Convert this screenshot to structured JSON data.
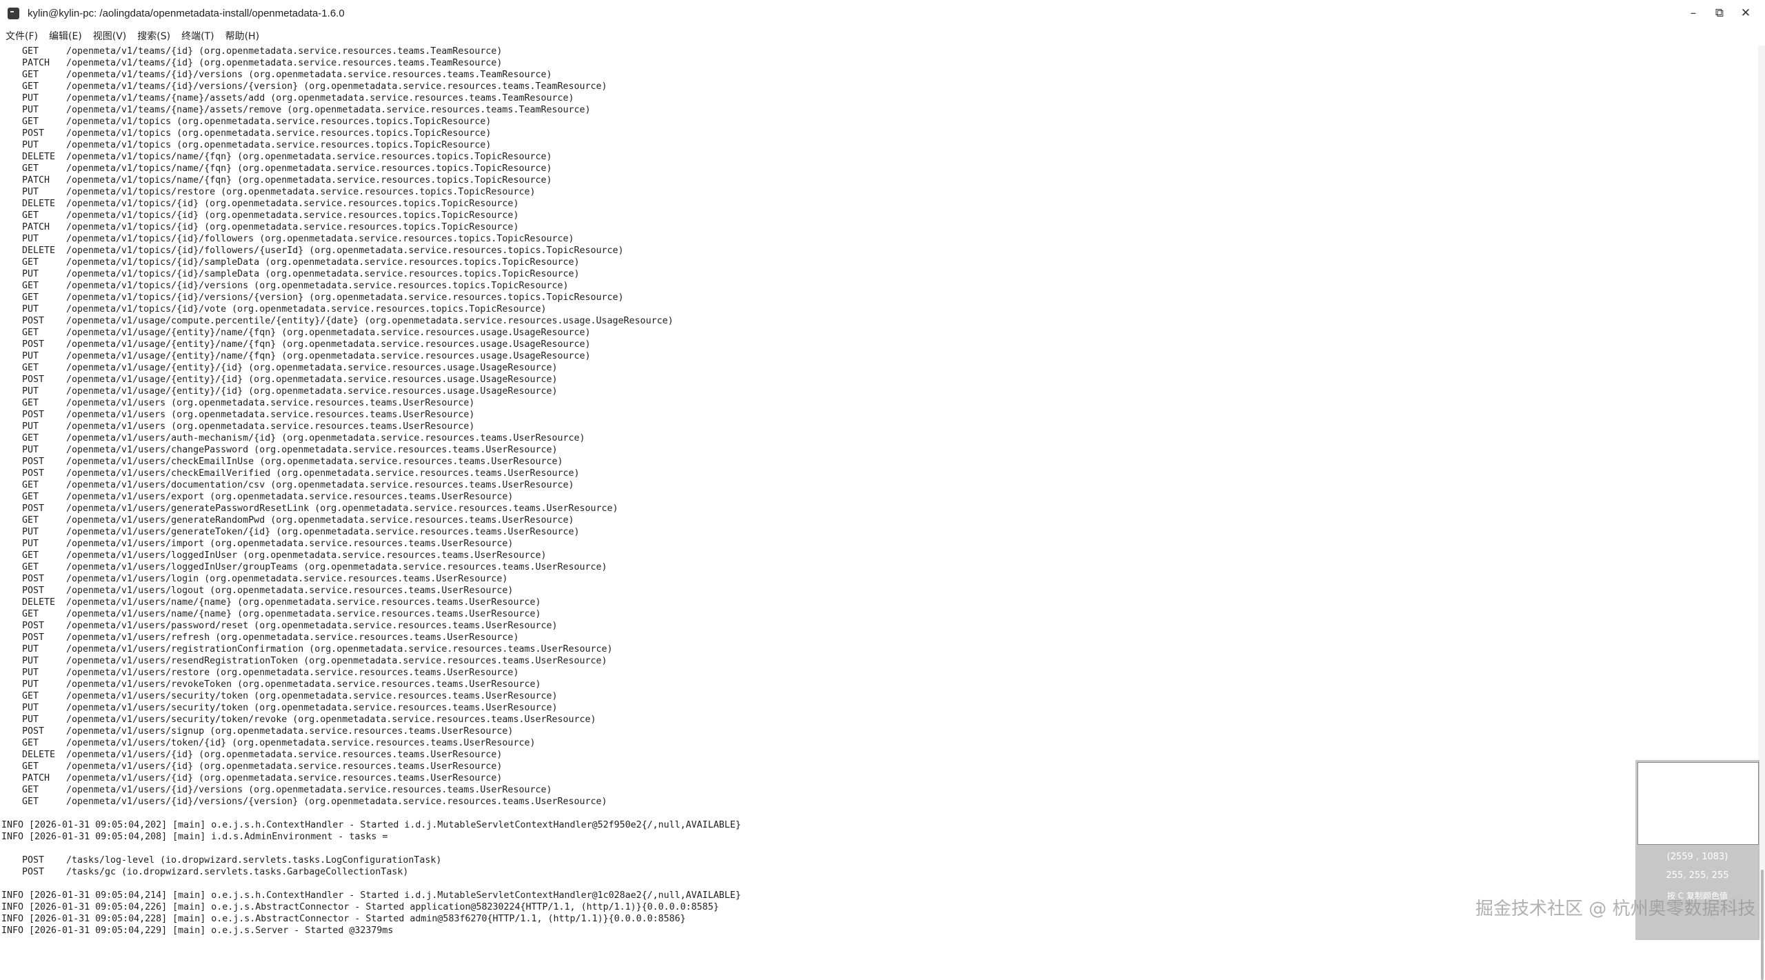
{
  "window": {
    "title": "kylin@kylin-pc: /aolingdata/openmetadata-install/openmetadata-1.6.0",
    "minimize_glyph": "–",
    "maximize_glyph": "⧉",
    "close_glyph": "✕"
  },
  "menu": [
    "文件(F)",
    "编辑(E)",
    "视图(V)",
    "搜索(S)",
    "终端(T)",
    "帮助(H)"
  ],
  "routes": [
    {
      "method": "GET",
      "path": "/openmeta/v1/teams/{id} (org.openmetadata.service.resources.teams.TeamResource)"
    },
    {
      "method": "PATCH",
      "path": "/openmeta/v1/teams/{id} (org.openmetadata.service.resources.teams.TeamResource)"
    },
    {
      "method": "GET",
      "path": "/openmeta/v1/teams/{id}/versions (org.openmetadata.service.resources.teams.TeamResource)"
    },
    {
      "method": "GET",
      "path": "/openmeta/v1/teams/{id}/versions/{version} (org.openmetadata.service.resources.teams.TeamResource)"
    },
    {
      "method": "PUT",
      "path": "/openmeta/v1/teams/{name}/assets/add (org.openmetadata.service.resources.teams.TeamResource)"
    },
    {
      "method": "PUT",
      "path": "/openmeta/v1/teams/{name}/assets/remove (org.openmetadata.service.resources.teams.TeamResource)"
    },
    {
      "method": "GET",
      "path": "/openmeta/v1/topics (org.openmetadata.service.resources.topics.TopicResource)"
    },
    {
      "method": "POST",
      "path": "/openmeta/v1/topics (org.openmetadata.service.resources.topics.TopicResource)"
    },
    {
      "method": "PUT",
      "path": "/openmeta/v1/topics (org.openmetadata.service.resources.topics.TopicResource)"
    },
    {
      "method": "DELETE",
      "path": "/openmeta/v1/topics/name/{fqn} (org.openmetadata.service.resources.topics.TopicResource)"
    },
    {
      "method": "GET",
      "path": "/openmeta/v1/topics/name/{fqn} (org.openmetadata.service.resources.topics.TopicResource)"
    },
    {
      "method": "PATCH",
      "path": "/openmeta/v1/topics/name/{fqn} (org.openmetadata.service.resources.topics.TopicResource)"
    },
    {
      "method": "PUT",
      "path": "/openmeta/v1/topics/restore (org.openmetadata.service.resources.topics.TopicResource)"
    },
    {
      "method": "DELETE",
      "path": "/openmeta/v1/topics/{id} (org.openmetadata.service.resources.topics.TopicResource)"
    },
    {
      "method": "GET",
      "path": "/openmeta/v1/topics/{id} (org.openmetadata.service.resources.topics.TopicResource)"
    },
    {
      "method": "PATCH",
      "path": "/openmeta/v1/topics/{id} (org.openmetadata.service.resources.topics.TopicResource)"
    },
    {
      "method": "PUT",
      "path": "/openmeta/v1/topics/{id}/followers (org.openmetadata.service.resources.topics.TopicResource)"
    },
    {
      "method": "DELETE",
      "path": "/openmeta/v1/topics/{id}/followers/{userId} (org.openmetadata.service.resources.topics.TopicResource)"
    },
    {
      "method": "GET",
      "path": "/openmeta/v1/topics/{id}/sampleData (org.openmetadata.service.resources.topics.TopicResource)"
    },
    {
      "method": "PUT",
      "path": "/openmeta/v1/topics/{id}/sampleData (org.openmetadata.service.resources.topics.TopicResource)"
    },
    {
      "method": "GET",
      "path": "/openmeta/v1/topics/{id}/versions (org.openmetadata.service.resources.topics.TopicResource)"
    },
    {
      "method": "GET",
      "path": "/openmeta/v1/topics/{id}/versions/{version} (org.openmetadata.service.resources.topics.TopicResource)"
    },
    {
      "method": "PUT",
      "path": "/openmeta/v1/topics/{id}/vote (org.openmetadata.service.resources.topics.TopicResource)"
    },
    {
      "method": "POST",
      "path": "/openmeta/v1/usage/compute.percentile/{entity}/{date} (org.openmetadata.service.resources.usage.UsageResource)"
    },
    {
      "method": "GET",
      "path": "/openmeta/v1/usage/{entity}/name/{fqn} (org.openmetadata.service.resources.usage.UsageResource)"
    },
    {
      "method": "POST",
      "path": "/openmeta/v1/usage/{entity}/name/{fqn} (org.openmetadata.service.resources.usage.UsageResource)"
    },
    {
      "method": "PUT",
      "path": "/openmeta/v1/usage/{entity}/name/{fqn} (org.openmetadata.service.resources.usage.UsageResource)"
    },
    {
      "method": "GET",
      "path": "/openmeta/v1/usage/{entity}/{id} (org.openmetadata.service.resources.usage.UsageResource)"
    },
    {
      "method": "POST",
      "path": "/openmeta/v1/usage/{entity}/{id} (org.openmetadata.service.resources.usage.UsageResource)"
    },
    {
      "method": "PUT",
      "path": "/openmeta/v1/usage/{entity}/{id} (org.openmetadata.service.resources.usage.UsageResource)"
    },
    {
      "method": "GET",
      "path": "/openmeta/v1/users (org.openmetadata.service.resources.teams.UserResource)"
    },
    {
      "method": "POST",
      "path": "/openmeta/v1/users (org.openmetadata.service.resources.teams.UserResource)"
    },
    {
      "method": "PUT",
      "path": "/openmeta/v1/users (org.openmetadata.service.resources.teams.UserResource)"
    },
    {
      "method": "GET",
      "path": "/openmeta/v1/users/auth-mechanism/{id} (org.openmetadata.service.resources.teams.UserResource)"
    },
    {
      "method": "PUT",
      "path": "/openmeta/v1/users/changePassword (org.openmetadata.service.resources.teams.UserResource)"
    },
    {
      "method": "POST",
      "path": "/openmeta/v1/users/checkEmailInUse (org.openmetadata.service.resources.teams.UserResource)"
    },
    {
      "method": "POST",
      "path": "/openmeta/v1/users/checkEmailVerified (org.openmetadata.service.resources.teams.UserResource)"
    },
    {
      "method": "GET",
      "path": "/openmeta/v1/users/documentation/csv (org.openmetadata.service.resources.teams.UserResource)"
    },
    {
      "method": "GET",
      "path": "/openmeta/v1/users/export (org.openmetadata.service.resources.teams.UserResource)"
    },
    {
      "method": "POST",
      "path": "/openmeta/v1/users/generatePasswordResetLink (org.openmetadata.service.resources.teams.UserResource)"
    },
    {
      "method": "GET",
      "path": "/openmeta/v1/users/generateRandomPwd (org.openmetadata.service.resources.teams.UserResource)"
    },
    {
      "method": "PUT",
      "path": "/openmeta/v1/users/generateToken/{id} (org.openmetadata.service.resources.teams.UserResource)"
    },
    {
      "method": "PUT",
      "path": "/openmeta/v1/users/import (org.openmetadata.service.resources.teams.UserResource)"
    },
    {
      "method": "GET",
      "path": "/openmeta/v1/users/loggedInUser (org.openmetadata.service.resources.teams.UserResource)"
    },
    {
      "method": "GET",
      "path": "/openmeta/v1/users/loggedInUser/groupTeams (org.openmetadata.service.resources.teams.UserResource)"
    },
    {
      "method": "POST",
      "path": "/openmeta/v1/users/login (org.openmetadata.service.resources.teams.UserResource)"
    },
    {
      "method": "POST",
      "path": "/openmeta/v1/users/logout (org.openmetadata.service.resources.teams.UserResource)"
    },
    {
      "method": "DELETE",
      "path": "/openmeta/v1/users/name/{name} (org.openmetadata.service.resources.teams.UserResource)"
    },
    {
      "method": "GET",
      "path": "/openmeta/v1/users/name/{name} (org.openmetadata.service.resources.teams.UserResource)"
    },
    {
      "method": "POST",
      "path": "/openmeta/v1/users/password/reset (org.openmetadata.service.resources.teams.UserResource)"
    },
    {
      "method": "POST",
      "path": "/openmeta/v1/users/refresh (org.openmetadata.service.resources.teams.UserResource)"
    },
    {
      "method": "PUT",
      "path": "/openmeta/v1/users/registrationConfirmation (org.openmetadata.service.resources.teams.UserResource)"
    },
    {
      "method": "PUT",
      "path": "/openmeta/v1/users/resendRegistrationToken (org.openmetadata.service.resources.teams.UserResource)"
    },
    {
      "method": "PUT",
      "path": "/openmeta/v1/users/restore (org.openmetadata.service.resources.teams.UserResource)"
    },
    {
      "method": "PUT",
      "path": "/openmeta/v1/users/revokeToken (org.openmetadata.service.resources.teams.UserResource)"
    },
    {
      "method": "GET",
      "path": "/openmeta/v1/users/security/token (org.openmetadata.service.resources.teams.UserResource)"
    },
    {
      "method": "PUT",
      "path": "/openmeta/v1/users/security/token (org.openmetadata.service.resources.teams.UserResource)"
    },
    {
      "method": "PUT",
      "path": "/openmeta/v1/users/security/token/revoke (org.openmetadata.service.resources.teams.UserResource)"
    },
    {
      "method": "POST",
      "path": "/openmeta/v1/users/signup (org.openmetadata.service.resources.teams.UserResource)"
    },
    {
      "method": "GET",
      "path": "/openmeta/v1/users/token/{id} (org.openmetadata.service.resources.teams.UserResource)"
    },
    {
      "method": "DELETE",
      "path": "/openmeta/v1/users/{id} (org.openmetadata.service.resources.teams.UserResource)"
    },
    {
      "method": "GET",
      "path": "/openmeta/v1/users/{id} (org.openmetadata.service.resources.teams.UserResource)"
    },
    {
      "method": "PATCH",
      "path": "/openmeta/v1/users/{id} (org.openmetadata.service.resources.teams.UserResource)"
    },
    {
      "method": "GET",
      "path": "/openmeta/v1/users/{id}/versions (org.openmetadata.service.resources.teams.UserResource)"
    },
    {
      "method": "GET",
      "path": "/openmeta/v1/users/{id}/versions/{version} (org.openmetadata.service.resources.teams.UserResource)"
    }
  ],
  "log1": [
    "INFO [2026-01-31 09:05:04,202] [main] o.e.j.s.h.ContextHandler - Started i.d.j.MutableServletContextHandler@52f950e2{/,null,AVAILABLE}",
    "INFO [2026-01-31 09:05:04,208] [main] i.d.s.AdminEnvironment - tasks ="
  ],
  "tasks": [
    {
      "method": "POST",
      "path": "/tasks/log-level (io.dropwizard.servlets.tasks.LogConfigurationTask)"
    },
    {
      "method": "POST",
      "path": "/tasks/gc (io.dropwizard.servlets.tasks.GarbageCollectionTask)"
    }
  ],
  "log2": [
    "INFO [2026-01-31 09:05:04,214] [main] o.e.j.s.h.ContextHandler - Started i.d.j.MutableServletContextHandler@1c028ae2{/,null,AVAILABLE}",
    "INFO [2026-01-31 09:05:04,226] [main] o.e.j.s.AbstractConnector - Started application@58230224{HTTP/1.1, (http/1.1)}{0.0.0.0:8585}",
    "INFO [2026-01-31 09:05:04,228] [main] o.e.j.s.AbstractConnector - Started admin@583f6270{HTTP/1.1, (http/1.1)}{0.0.0.0:8586}",
    "INFO [2026-01-31 09:05:04,229] [main] o.e.j.s.Server - Started @32379ms"
  ],
  "picker": {
    "coords": "(2559 , 1083)",
    "rgb": "255, 255, 255",
    "hint": "按 C 复制颜色值"
  },
  "watermark": "掘金技术社区 @ 杭州奥零数据科技"
}
